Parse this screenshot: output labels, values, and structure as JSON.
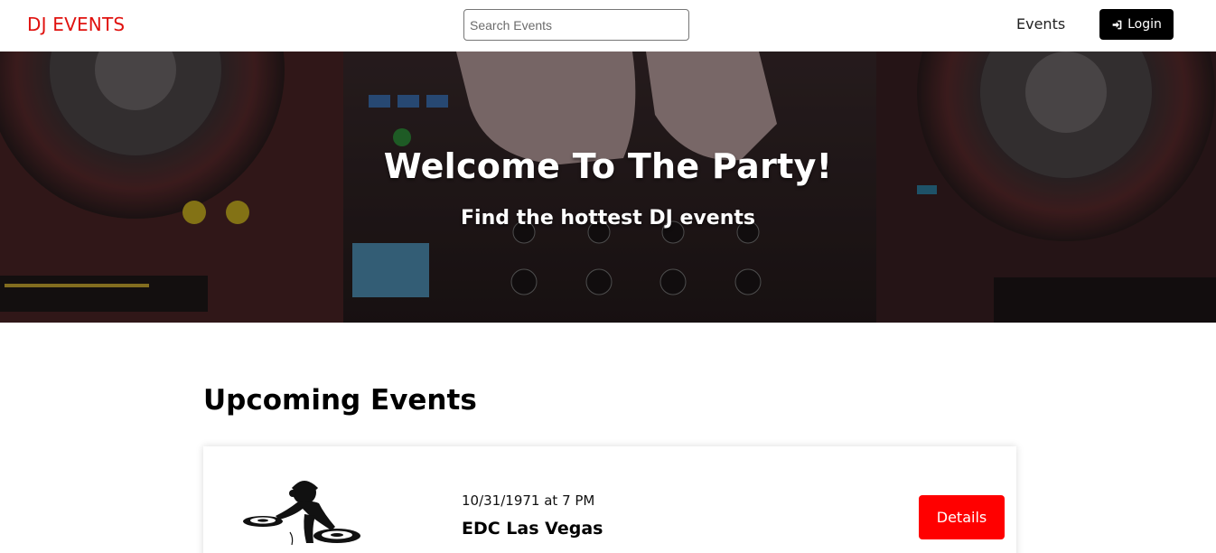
{
  "header": {
    "logo": "DJ EVENTS",
    "search_placeholder": "Search Events",
    "nav_events": "Events",
    "login_label": "Login",
    "login_icon": "sign-in-icon"
  },
  "hero": {
    "title": "Welcome To The Party!",
    "subtitle": "Find the hottest DJ events",
    "background": "dj-mixer-photo"
  },
  "main": {
    "section_title": "Upcoming Events",
    "events": [
      {
        "date": "10/31/1971 at 7 PM",
        "name": "EDC Las Vegas",
        "image": "dj-silhouette-image",
        "details_label": "Details"
      }
    ]
  },
  "colors": {
    "brand": "#e0120f",
    "details_button": "#ff0000",
    "login_button": "#000000"
  }
}
